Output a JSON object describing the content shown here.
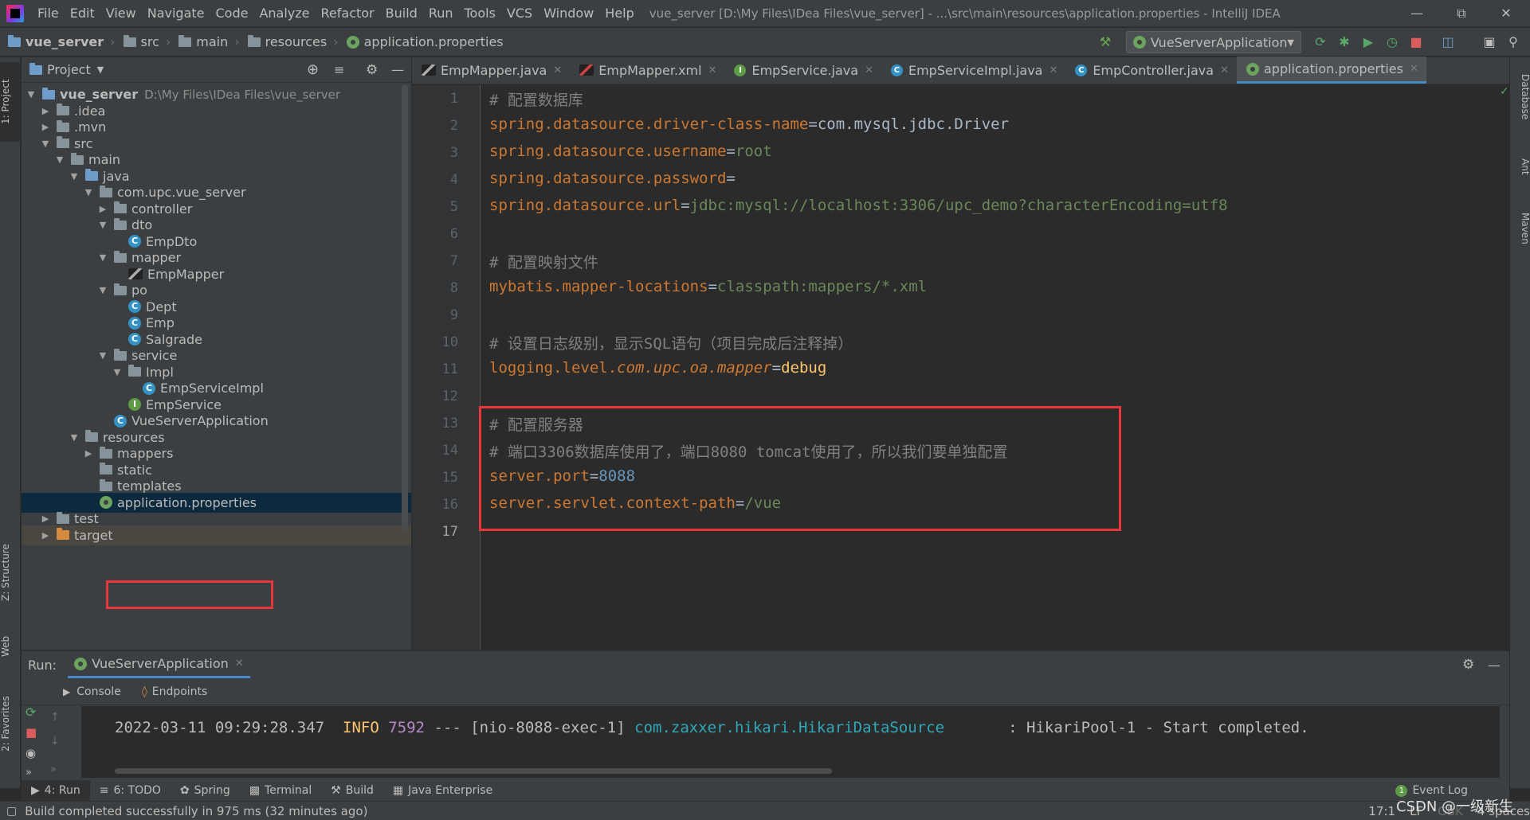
{
  "window": {
    "title": "vue_server [D:\\My Files\\IDea Files\\vue_server] - ...\\src\\main\\resources\\application.properties - IntelliJ IDEA"
  },
  "menu": [
    "File",
    "Edit",
    "View",
    "Navigate",
    "Code",
    "Analyze",
    "Refactor",
    "Build",
    "Run",
    "Tools",
    "VCS",
    "Window",
    "Help"
  ],
  "breadcrumb": [
    "vue_server",
    "src",
    "main",
    "resources",
    "application.properties"
  ],
  "run_config": "VueServerApplication",
  "project_panel": {
    "title": "Project",
    "root_name": "vue_server",
    "root_path": "D:\\My Files\\IDea Files\\vue_server",
    "nodes": [
      ".idea",
      ".mvn",
      "src",
      "main",
      "java",
      "com.upc.vue_server",
      "controller",
      "dto",
      "EmpDto",
      "mapper",
      "EmpMapper",
      "po",
      "Dept",
      "Emp",
      "Salgrade",
      "service",
      "Impl",
      "EmpServiceImpl",
      "EmpService",
      "VueServerApplication",
      "resources",
      "mappers",
      "static",
      "templates",
      "application.properties",
      "test",
      "target"
    ]
  },
  "tabs": [
    "EmpMapper.java",
    "EmpMapper.xml",
    "EmpService.java",
    "EmpServiceImpl.java",
    "EmpController.java",
    "application.properties"
  ],
  "editor": {
    "line_numbers": [
      "1",
      "2",
      "3",
      "4",
      "5",
      "6",
      "7",
      "8",
      "9",
      "10",
      "11",
      "12",
      "13",
      "14",
      "15",
      "16",
      "17"
    ],
    "l1": "# 配置数据库",
    "l2k": "spring.datasource.driver-class-name",
    "l2v": "com.mysql.jdbc.Driver",
    "l3k": "spring.datasource.username",
    "l3v": "root",
    "l4k": "spring.datasource.password",
    "l5k": "spring.datasource.url",
    "l5v": "jdbc:mysql://localhost:3306/upc_demo?characterEncoding=utf8",
    "l7": "# 配置映射文件",
    "l8k": "mybatis.mapper-locations",
    "l8v": "classpath:mappers/*.xml",
    "l10": "# 设置日志级别，显示SQL语句（项目完成后注释掉）",
    "l11a": "logging.level.",
    "l11b": "com.upc.oa.mapper",
    "l11v": "debug",
    "l13": "# 配置服务器",
    "l14": "# 端口3306数据库使用了，端口8080 tomcat使用了，所以我们要单独配置",
    "l15k": "server.port",
    "l15v": "8088",
    "l16k": "server.servlet.context-path",
    "l16v": "/vue",
    "eq": "="
  },
  "run_panel": {
    "label": "Run:",
    "tab": "VueServerApplication",
    "subtabs": [
      "Console",
      "Endpoints"
    ],
    "log_time": "2022-03-11 09:29:28.347",
    "log_level": "INFO",
    "log_pid": "7592",
    "log_sep": "---",
    "log_thread": "[nio-8088-exec-1]",
    "log_class": "com.zaxxer.hikari.HikariDataSource",
    "log_msg": ": HikariPool-1 - Start completed."
  },
  "bottom_tabs": [
    "4: Run",
    "6: TODO",
    "Spring",
    "Terminal",
    "Build",
    "Java Enterprise"
  ],
  "event_log": "Event Log",
  "event_count": "1",
  "status": {
    "message": "Build completed successfully in 975 ms (32 minutes ago)",
    "position": "17:1",
    "line_sep": "LF",
    "encoding": "GBK",
    "indent": "4 spaces",
    "watermark": "CSDN @一级新生"
  },
  "side_tabs": {
    "left": [
      "1: Project",
      "Z: Structure",
      "Web",
      "2: Favorites"
    ],
    "right": [
      "Database",
      "Ant",
      "Maven"
    ]
  }
}
